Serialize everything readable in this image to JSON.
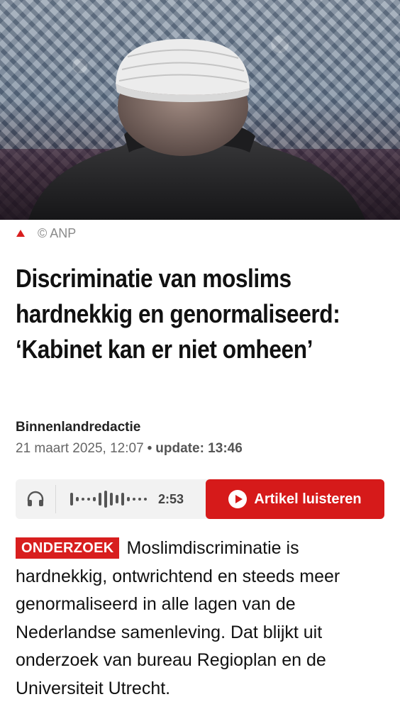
{
  "hero": {
    "alt": "Man met wit gehaakt gebedskapje in een moskee"
  },
  "caption": {
    "credit": "© ANP"
  },
  "article": {
    "headline": "Discriminatie van moslims hardnekkig en genormaliseerd: ‘Kabinet kan er niet omheen’",
    "author": "Binnenlandredactie",
    "date": "21 maart 2025, 12:07",
    "separator": "•",
    "update": "update: 13:46",
    "badge": "ONDERZOEK",
    "intro": "Moslimdiscriminatie is hardnekkig, ontwrichtend en steeds meer genormaliseerd in alle lagen van de Nederlandse samenleving. Dat blijkt uit onderzoek van bureau Regioplan en de Universiteit Utrecht."
  },
  "audio": {
    "duration": "2:53",
    "listen_label": "Artikel luisteren"
  },
  "colors": {
    "accent": "#d61a1a",
    "badge": "#d81e1e",
    "audio_bg": "#f2f2f2",
    "muted_text": "#666666"
  },
  "icons": {
    "caption": "triangle-up-icon",
    "audio": "headphones-icon",
    "waveform": "waveform-icon",
    "play": "play-icon"
  }
}
